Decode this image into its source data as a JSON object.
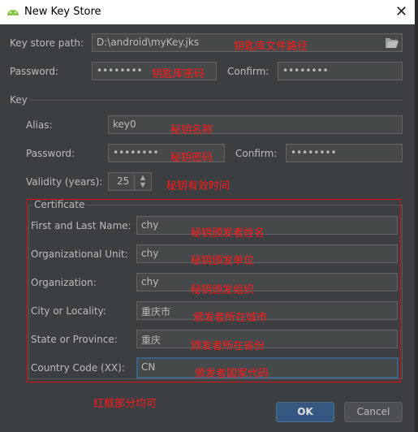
{
  "window": {
    "title": "New Key Store",
    "close_icon": "close-icon",
    "app_icon": "android-icon"
  },
  "keystore": {
    "path_label": "Key store path:",
    "path_value": "D:\\android\\myKey.jks",
    "password_label": "Password:",
    "password_value": "••••••••",
    "confirm_label": "Confirm:",
    "confirm_value": "••••••••"
  },
  "key": {
    "section_label": "Key",
    "alias_label": "Alias:",
    "alias_value": "key0",
    "password_label": "Password:",
    "password_value": "••••••••",
    "confirm_label": "Confirm:",
    "confirm_value": "••••••••",
    "validity_label": "Validity (years):",
    "validity_value": "25"
  },
  "certificate": {
    "group_label": "Certificate",
    "fields": [
      {
        "label": "First and Last Name:",
        "value": "chy"
      },
      {
        "label": "Organizational Unit:",
        "value": "chy"
      },
      {
        "label": "Organization:",
        "value": "chy"
      },
      {
        "label": "City or Locality:",
        "value": "重庆市"
      },
      {
        "label": "State or Province:",
        "value": "重庆"
      },
      {
        "label": "Country Code (XX):",
        "value": "CN"
      }
    ]
  },
  "annotations": {
    "path": "钥匙库文件路径",
    "store_password": "钥匙库密码",
    "alias": "秘钥名称",
    "key_password": "秘钥密码",
    "validity": "秘钥有效时间",
    "name": "秘钥颁发者姓名",
    "unit": "秘钥颁发单位",
    "org": "秘钥颁发组织",
    "city": "颁发者所在城市",
    "state": "颁发者所在省份",
    "country": "颁发者国家代码",
    "footer": "红框部分均可"
  },
  "buttons": {
    "ok": "OK",
    "cancel": "Cancel"
  },
  "colors": {
    "background": "#3c3f41",
    "field": "#45494a",
    "accent": "#365880",
    "annotation": "#ff1a1a"
  }
}
